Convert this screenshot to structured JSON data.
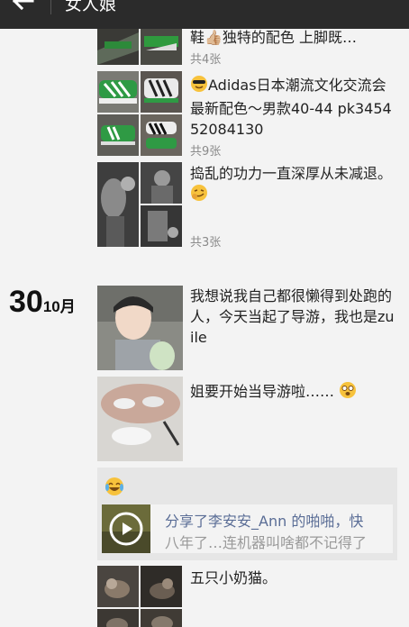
{
  "header": {
    "title": "女人娘",
    "back_icon": "arrow-left-icon"
  },
  "posts": [
    {
      "text": "鞋👍🏼独特的配色 上脚既…",
      "count": "共4张"
    },
    {
      "text": "Adidas日本潮流文化交流会最新配色～男款40-44 pk345452084130",
      "count": "共9张",
      "emoji": "cool-face-emoji"
    },
    {
      "text": "捣乱的功力一直深厚从未减退。",
      "count": "共3张",
      "emoji": "smirk-emoji"
    }
  ],
  "date_group": {
    "day": "30",
    "month": "10月"
  },
  "posts2": [
    {
      "text": "我想说我自己都很懒得到处跑的人，今天当起了导游，我也是zuile"
    },
    {
      "text": "姐要开始当导游啦……",
      "emoji": "dizzy-face-emoji"
    }
  ],
  "share": {
    "emoji": "laughing-tears-emoji",
    "line1": "分享了李安安_Ann 的啪啪，快",
    "line2": "八年了…连机器叫啥都不记得了",
    "play_icon": "play-icon"
  },
  "last_post": {
    "text": "五只小奶猫。"
  }
}
